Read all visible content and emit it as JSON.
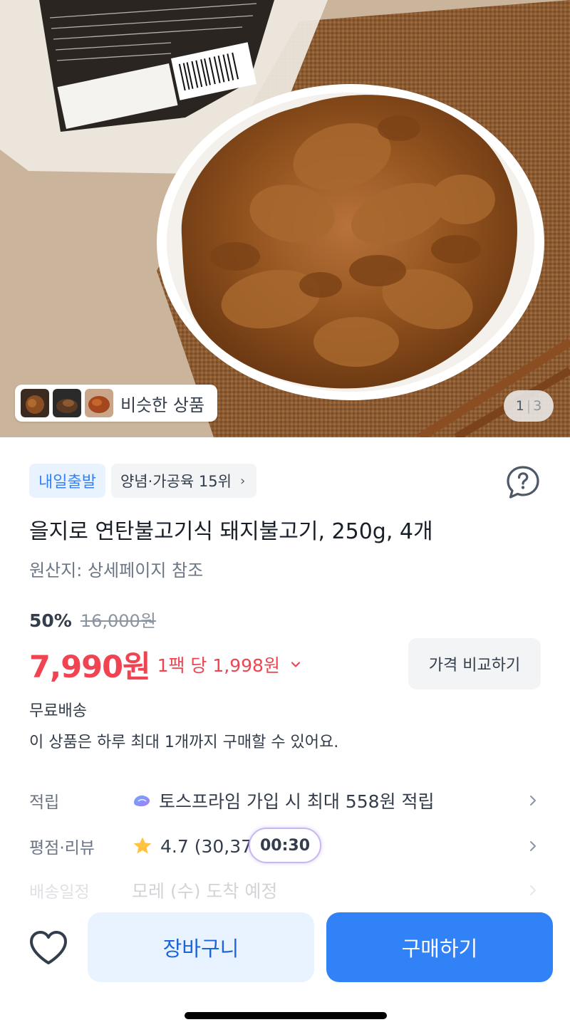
{
  "hero": {
    "similar_products_label": "비슷한 상품",
    "page_current": "1",
    "page_total": "3"
  },
  "badges": {
    "delivery": "내일출발",
    "rank": "양념·가공육 15위"
  },
  "product": {
    "title": "을지로 연탄불고기식 돼지불고기, 250g, 4개",
    "origin": "원산지: 상세페이지 참조"
  },
  "price": {
    "discount_rate": "50%",
    "original_price": "16,000원",
    "sale_price": "7,990원",
    "unit_price": "1팩 당 1,998원",
    "compare_button": "가격 비교하기"
  },
  "shipping": {
    "fee": "무료배송",
    "purchase_limit": "이 상품은 하루 최대 1개까지 구매할 수 있어요."
  },
  "info_rows": {
    "points": {
      "label": "적립",
      "value": "토스프라임 가입 시 최대 558원 적립"
    },
    "rating": {
      "label": "평점·리뷰",
      "value": "4.7 (30,37"
    },
    "delivery": {
      "label": "배송일정",
      "value": "모레 (수) 도착 예정"
    }
  },
  "timer": "00:30",
  "bottom_bar": {
    "cart_button": "장바구니",
    "buy_button": "구매하기"
  },
  "colors": {
    "accent_blue": "#3182f6",
    "price_red": "#f04452",
    "star_yellow": "#ffc342"
  },
  "icons": {
    "help": "question-bubble-icon",
    "like": "heart-outline-icon",
    "chevron": "chevron-right-icon",
    "star": "star-icon",
    "prime": "toss-prime-icon"
  }
}
